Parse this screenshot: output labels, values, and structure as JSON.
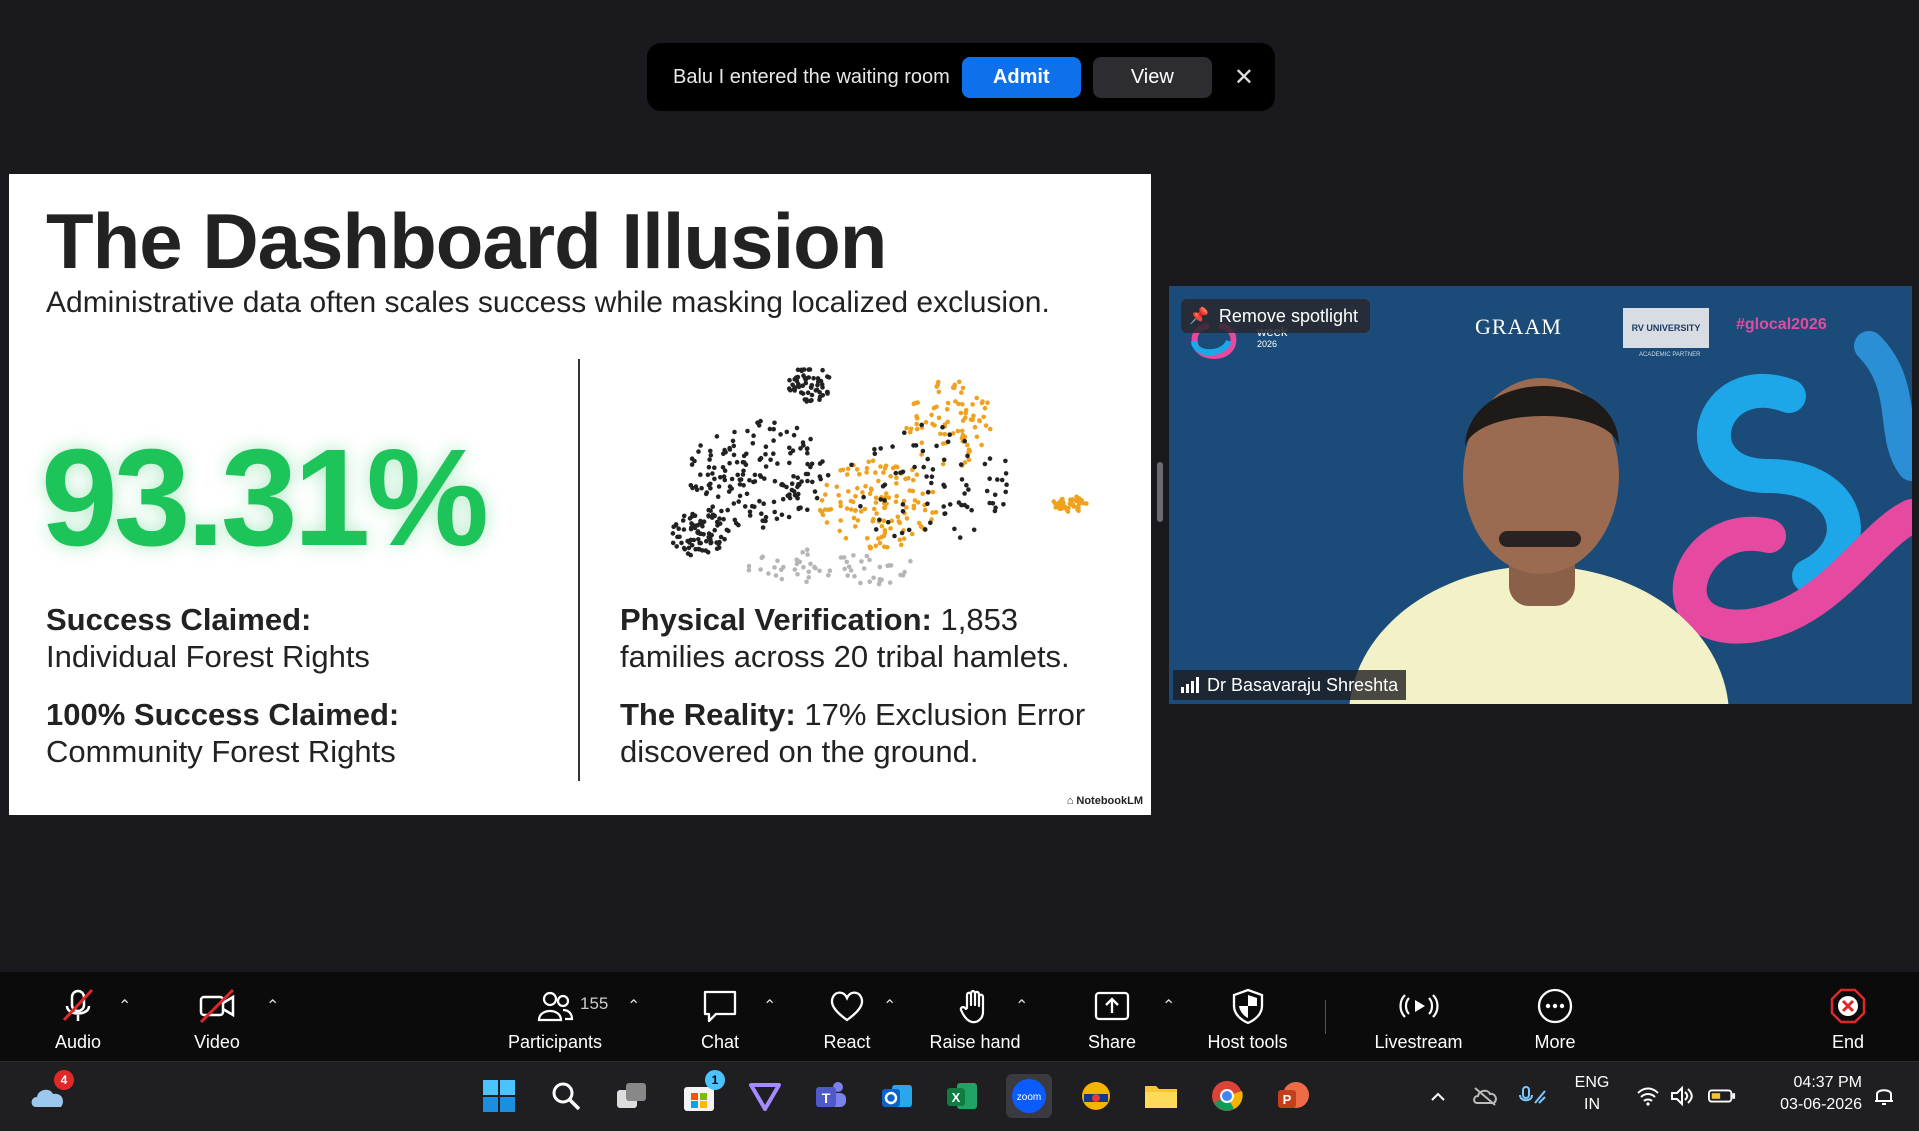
{
  "notification": {
    "message": "Balu I entered the waiting room",
    "admit_label": "Admit",
    "view_label": "View",
    "close_glyph": "✕"
  },
  "slide": {
    "title": "The Dashboard Illusion",
    "subtitle": "Administrative data often scales success while masking localized exclusion.",
    "big_number": "93.31%",
    "left_claims": [
      {
        "heading": "Success Claimed:",
        "body": "Individual Forest Rights"
      },
      {
        "heading": "100% Success Claimed:",
        "body": "Community Forest Rights"
      }
    ],
    "right_points": [
      {
        "heading": "Physical Verification:",
        "body_inline": " 1,853",
        "body_next": "families across 20 tribal hamlets."
      },
      {
        "heading": "The Reality:",
        "body_inline": " 17% Exclusion Error",
        "body_next": "discovered on the ground."
      }
    ],
    "watermark": "NotebookLM",
    "colors": {
      "accent_green": "#1dc45a",
      "dot_dark": "#222222",
      "dot_orange": "#f0a21e"
    }
  },
  "video": {
    "spotlight_label": "Remove spotlight",
    "speaker_name": "Dr Basavaraju Shreshta",
    "logo_evo": "week",
    "logo_evo_year": "2026",
    "logo_graam": "GRAAM",
    "logo_rv": "RV UNIVERSITY",
    "logo_rv_sub": "ACADEMIC PARTNER",
    "hashtag": "#glocal2026",
    "colors": {
      "background": "#1b4b78",
      "brand_pink": "#e54aa0",
      "brand_blue": "#1ea7e8"
    }
  },
  "toolbar": {
    "audio": "Audio",
    "video": "Video",
    "participants": "Participants",
    "participants_count": "155",
    "chat": "Chat",
    "react": "React",
    "raise_hand": "Raise hand",
    "share": "Share",
    "host_tools": "Host tools",
    "livestream": "Livestream",
    "more": "More",
    "end": "End",
    "colors": {
      "end_red": "#e02828",
      "mute_red": "#e02828"
    }
  },
  "taskbar": {
    "weather_badge": "4",
    "store_badge": "1",
    "zoom_label": "zoom",
    "lang_top": "ENG",
    "lang_bottom": "IN",
    "time": "04:37 PM",
    "date": "03-06-2026"
  }
}
